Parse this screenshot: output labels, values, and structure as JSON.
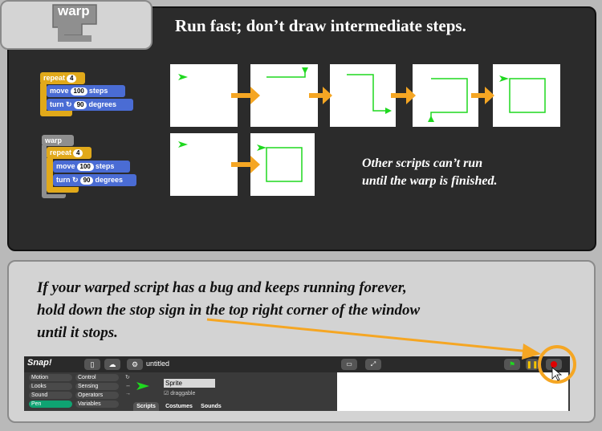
{
  "top_tab": {
    "label": "warp"
  },
  "heading": "Run fast; don’t draw intermediate steps.",
  "script1": {
    "repeat_label": "repeat",
    "repeat_count": "4",
    "move_label": "move",
    "move_value": "100",
    "move_unit": "steps",
    "turn_label": "turn",
    "turn_value": "90",
    "turn_unit": "degrees"
  },
  "script2": {
    "warp_label": "warp",
    "repeat_label": "repeat",
    "repeat_count": "4",
    "move_label": "move",
    "move_value": "100",
    "move_unit": "steps",
    "turn_label": "turn",
    "turn_value": "90",
    "turn_unit": "degrees"
  },
  "note": {
    "line1": "Other scripts can’t run",
    "line2": "until the warp is finished."
  },
  "bottom": {
    "line1": "If your warped script has a bug and keeps running forever,",
    "line2": "hold down the stop sign in the top right corner of the window",
    "line3": "until it stops."
  },
  "snap": {
    "logo": "Snap!",
    "project_title": "untitled",
    "categories": [
      "Motion",
      "Control",
      "Looks",
      "Sensing",
      "Sound",
      "Operators",
      "Pen",
      "Variables"
    ],
    "sprite_name": "Sprite",
    "draggable_label": "draggable",
    "tabs": [
      "Scripts",
      "Costumes",
      "Sounds"
    ]
  },
  "colors": {
    "accent_orange": "#f5a623",
    "motion_blue": "#4a6cd4",
    "control_gold": "#e1a91a",
    "warp_gray": "#8f8f8f",
    "trail_green": "#1fd81f"
  }
}
